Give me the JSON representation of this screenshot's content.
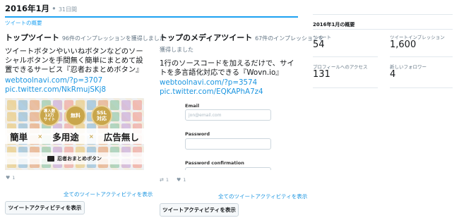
{
  "header": {
    "month": "2016年1月",
    "separator": "•",
    "days": "31日間"
  },
  "section_label": "ツイートの概要",
  "top_tweet": {
    "title": "トップツイート",
    "impressions_note": "96件のインプレッションを獲得しました",
    "text": "ツイートボタンやいいねボタンなどのソーシャルボタンを手間無く簡単にまとめて設置できるサービス『忍者おまとめボタン』",
    "links": [
      "webtoolnavi.com/?p=3707",
      "pic.twitter.com/NkRmujSKj8"
    ],
    "image": {
      "badges": [
        "導入数\n12万\nサイト",
        "無料",
        "SSL\n対応"
      ],
      "band": [
        "簡単",
        "多用途",
        "広告無し"
      ],
      "band_sep": "×",
      "footer": "忍者おまとめボタン"
    },
    "likes": "1",
    "activity_link": "全てのツイートアクティビティを表示",
    "button": "ツイートアクティビティを表示"
  },
  "top_media_tweet": {
    "title": "トップのメディアツイート",
    "impressions_note_1": "67件のインプレッションを",
    "impressions_note_2": "獲得しました",
    "text": "1行のソースコードを加えるだけで、サイトを多言語化対応できる『Wovn.io』",
    "links": [
      "webtoolnavi.com/?p=3574",
      "pic.twitter.com/EQKAPhA7z4"
    ],
    "form": {
      "email_label": "Email",
      "email_placeholder": "jon@email.com",
      "password_label": "Password",
      "confirm_label": "Password confirmation"
    },
    "retweets": "1",
    "likes": "1",
    "activity_link": "全てのツイートアクティビティを表示",
    "button": "ツイートアクティビティを表示"
  },
  "summary": {
    "title": "2016年1月の概要",
    "tweets_label": "ツイート",
    "tweets_value": "54",
    "impressions_label": "ツイートインプレッション",
    "impressions_value": "1,600",
    "profile_label": "プロフィールへのアクセス",
    "profile_value": "131",
    "followers_label": "新しいフォロワー",
    "followers_value": "4"
  },
  "colors": {
    "accent": "#1da1f2",
    "link": "#1b95e0",
    "badge_gold": "#c9a64b"
  }
}
